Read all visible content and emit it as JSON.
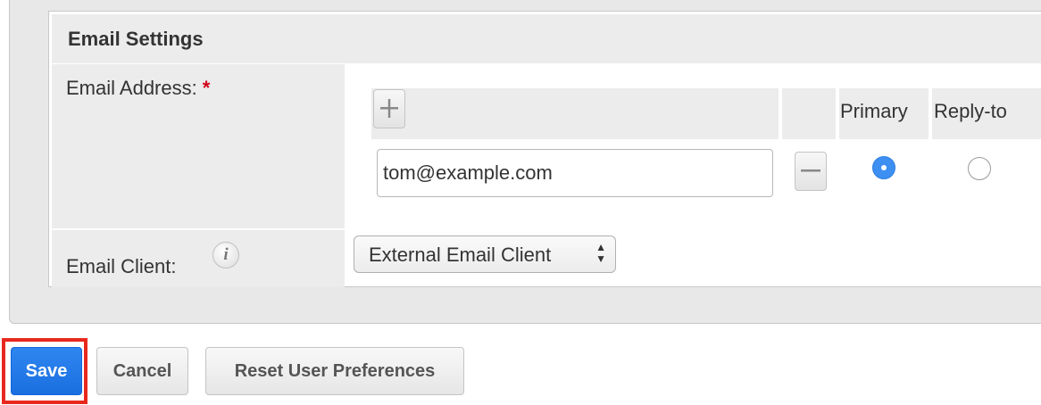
{
  "email_settings": {
    "title": "Email Settings",
    "email_address_label": "Email Address:",
    "required_marker": "*",
    "columns": {
      "primary": "Primary",
      "reply_to": "Reply-to"
    },
    "email_value": "tom@example.com",
    "primary_selected": true,
    "reply_to_selected": false,
    "email_client_label": "Email Client:",
    "email_client_value": "External Email Client",
    "info_glyph": "i"
  },
  "icons": {
    "add": "plus-icon",
    "remove": "minus-icon",
    "info": "info-icon",
    "select": "sort-arrows-icon"
  },
  "buttons": {
    "save": "Save",
    "cancel": "Cancel",
    "reset": "Reset User Preferences"
  },
  "colors": {
    "accent": "#1a6fe0",
    "highlight": "#e8281e",
    "required": "#d0021b"
  }
}
